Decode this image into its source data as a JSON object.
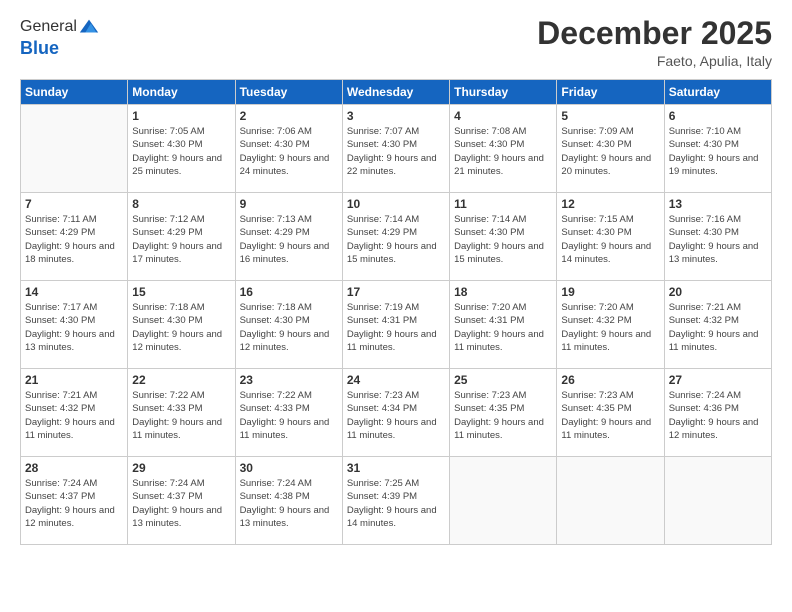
{
  "logo": {
    "general": "General",
    "blue": "Blue"
  },
  "title": "December 2025",
  "location": "Faeto, Apulia, Italy",
  "days_of_week": [
    "Sunday",
    "Monday",
    "Tuesday",
    "Wednesday",
    "Thursday",
    "Friday",
    "Saturday"
  ],
  "weeks": [
    [
      {
        "day": "",
        "sunrise": "",
        "sunset": "",
        "daylight": ""
      },
      {
        "day": "1",
        "sunrise": "Sunrise: 7:05 AM",
        "sunset": "Sunset: 4:30 PM",
        "daylight": "Daylight: 9 hours and 25 minutes."
      },
      {
        "day": "2",
        "sunrise": "Sunrise: 7:06 AM",
        "sunset": "Sunset: 4:30 PM",
        "daylight": "Daylight: 9 hours and 24 minutes."
      },
      {
        "day": "3",
        "sunrise": "Sunrise: 7:07 AM",
        "sunset": "Sunset: 4:30 PM",
        "daylight": "Daylight: 9 hours and 22 minutes."
      },
      {
        "day": "4",
        "sunrise": "Sunrise: 7:08 AM",
        "sunset": "Sunset: 4:30 PM",
        "daylight": "Daylight: 9 hours and 21 minutes."
      },
      {
        "day": "5",
        "sunrise": "Sunrise: 7:09 AM",
        "sunset": "Sunset: 4:30 PM",
        "daylight": "Daylight: 9 hours and 20 minutes."
      },
      {
        "day": "6",
        "sunrise": "Sunrise: 7:10 AM",
        "sunset": "Sunset: 4:30 PM",
        "daylight": "Daylight: 9 hours and 19 minutes."
      }
    ],
    [
      {
        "day": "7",
        "sunrise": "Sunrise: 7:11 AM",
        "sunset": "Sunset: 4:29 PM",
        "daylight": "Daylight: 9 hours and 18 minutes."
      },
      {
        "day": "8",
        "sunrise": "Sunrise: 7:12 AM",
        "sunset": "Sunset: 4:29 PM",
        "daylight": "Daylight: 9 hours and 17 minutes."
      },
      {
        "day": "9",
        "sunrise": "Sunrise: 7:13 AM",
        "sunset": "Sunset: 4:29 PM",
        "daylight": "Daylight: 9 hours and 16 minutes."
      },
      {
        "day": "10",
        "sunrise": "Sunrise: 7:14 AM",
        "sunset": "Sunset: 4:29 PM",
        "daylight": "Daylight: 9 hours and 15 minutes."
      },
      {
        "day": "11",
        "sunrise": "Sunrise: 7:14 AM",
        "sunset": "Sunset: 4:30 PM",
        "daylight": "Daylight: 9 hours and 15 minutes."
      },
      {
        "day": "12",
        "sunrise": "Sunrise: 7:15 AM",
        "sunset": "Sunset: 4:30 PM",
        "daylight": "Daylight: 9 hours and 14 minutes."
      },
      {
        "day": "13",
        "sunrise": "Sunrise: 7:16 AM",
        "sunset": "Sunset: 4:30 PM",
        "daylight": "Daylight: 9 hours and 13 minutes."
      }
    ],
    [
      {
        "day": "14",
        "sunrise": "Sunrise: 7:17 AM",
        "sunset": "Sunset: 4:30 PM",
        "daylight": "Daylight: 9 hours and 13 minutes."
      },
      {
        "day": "15",
        "sunrise": "Sunrise: 7:18 AM",
        "sunset": "Sunset: 4:30 PM",
        "daylight": "Daylight: 9 hours and 12 minutes."
      },
      {
        "day": "16",
        "sunrise": "Sunrise: 7:18 AM",
        "sunset": "Sunset: 4:30 PM",
        "daylight": "Daylight: 9 hours and 12 minutes."
      },
      {
        "day": "17",
        "sunrise": "Sunrise: 7:19 AM",
        "sunset": "Sunset: 4:31 PM",
        "daylight": "Daylight: 9 hours and 11 minutes."
      },
      {
        "day": "18",
        "sunrise": "Sunrise: 7:20 AM",
        "sunset": "Sunset: 4:31 PM",
        "daylight": "Daylight: 9 hours and 11 minutes."
      },
      {
        "day": "19",
        "sunrise": "Sunrise: 7:20 AM",
        "sunset": "Sunset: 4:32 PM",
        "daylight": "Daylight: 9 hours and 11 minutes."
      },
      {
        "day": "20",
        "sunrise": "Sunrise: 7:21 AM",
        "sunset": "Sunset: 4:32 PM",
        "daylight": "Daylight: 9 hours and 11 minutes."
      }
    ],
    [
      {
        "day": "21",
        "sunrise": "Sunrise: 7:21 AM",
        "sunset": "Sunset: 4:32 PM",
        "daylight": "Daylight: 9 hours and 11 minutes."
      },
      {
        "day": "22",
        "sunrise": "Sunrise: 7:22 AM",
        "sunset": "Sunset: 4:33 PM",
        "daylight": "Daylight: 9 hours and 11 minutes."
      },
      {
        "day": "23",
        "sunrise": "Sunrise: 7:22 AM",
        "sunset": "Sunset: 4:33 PM",
        "daylight": "Daylight: 9 hours and 11 minutes."
      },
      {
        "day": "24",
        "sunrise": "Sunrise: 7:23 AM",
        "sunset": "Sunset: 4:34 PM",
        "daylight": "Daylight: 9 hours and 11 minutes."
      },
      {
        "day": "25",
        "sunrise": "Sunrise: 7:23 AM",
        "sunset": "Sunset: 4:35 PM",
        "daylight": "Daylight: 9 hours and 11 minutes."
      },
      {
        "day": "26",
        "sunrise": "Sunrise: 7:23 AM",
        "sunset": "Sunset: 4:35 PM",
        "daylight": "Daylight: 9 hours and 11 minutes."
      },
      {
        "day": "27",
        "sunrise": "Sunrise: 7:24 AM",
        "sunset": "Sunset: 4:36 PM",
        "daylight": "Daylight: 9 hours and 12 minutes."
      }
    ],
    [
      {
        "day": "28",
        "sunrise": "Sunrise: 7:24 AM",
        "sunset": "Sunset: 4:37 PM",
        "daylight": "Daylight: 9 hours and 12 minutes."
      },
      {
        "day": "29",
        "sunrise": "Sunrise: 7:24 AM",
        "sunset": "Sunset: 4:37 PM",
        "daylight": "Daylight: 9 hours and 13 minutes."
      },
      {
        "day": "30",
        "sunrise": "Sunrise: 7:24 AM",
        "sunset": "Sunset: 4:38 PM",
        "daylight": "Daylight: 9 hours and 13 minutes."
      },
      {
        "day": "31",
        "sunrise": "Sunrise: 7:25 AM",
        "sunset": "Sunset: 4:39 PM",
        "daylight": "Daylight: 9 hours and 14 minutes."
      },
      {
        "day": "",
        "sunrise": "",
        "sunset": "",
        "daylight": ""
      },
      {
        "day": "",
        "sunrise": "",
        "sunset": "",
        "daylight": ""
      },
      {
        "day": "",
        "sunrise": "",
        "sunset": "",
        "daylight": ""
      }
    ]
  ]
}
